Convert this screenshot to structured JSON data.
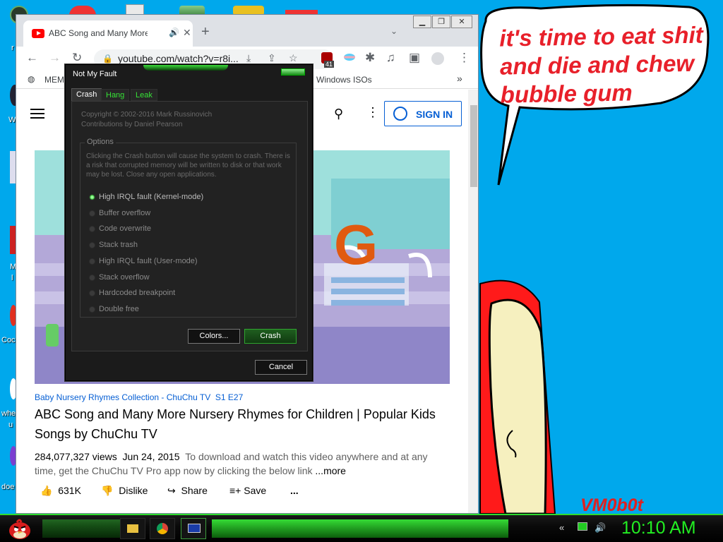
{
  "desktop": {
    "icon_labels": [
      "r",
      "W",
      "M",
      "l",
      "Coc",
      "whe",
      "u",
      "doe"
    ]
  },
  "drawing": {
    "speech_lines": [
      "it's time to eat shit",
      "and die and chew",
      "bubble gum"
    ],
    "signature": "VM0b0t",
    "colors": {
      "text": "#e8202a",
      "blob": "#ff1a1a",
      "skin": "#f6f0bf",
      "sky": "#00a8ec"
    }
  },
  "browser": {
    "tab_title": "ABC Song and Many More N",
    "tab_new_label": "+",
    "tab_search_icon": "chevron-down-icon",
    "window_buttons": [
      "minimize",
      "restore",
      "close"
    ],
    "url": "youtube.com/watch?v=r8i...",
    "extension_badge": "41",
    "bookmarks": [
      "MEMZ",
      "Windows ISOs"
    ],
    "bookmark_overflow": "»"
  },
  "youtube": {
    "sign_in_label": "SIGN IN",
    "channel": "Baby Nursery Rhymes Collection - ChuChu TV",
    "episode": "S1 E27",
    "title": "ABC Song and Many More Nursery Rhymes for Children | Popular Kids Songs by ChuChu TV",
    "views": "284,077,327 views",
    "date": "Jun 24, 2015",
    "description": "To download and watch this video anywhere and at any time, get the ChuChu TV Pro app now by clicking the below link",
    "more_label": "...more",
    "likes": "631K",
    "dislike_label": "Dislike",
    "share_label": "Share",
    "save_label": "Save",
    "more_actions": "...",
    "thumbnail_letter": "G"
  },
  "notmyfault": {
    "title": "Not My Fault",
    "tabs": [
      "Crash",
      "Hang",
      "Leak"
    ],
    "active_tab": "Crash",
    "copyright": "Copyright © 2002-2016 Mark Russinovich",
    "contributions": "Contributions by Daniel Pearson",
    "options_label": "Options",
    "warning": "Clicking the Crash button will cause the system to crash. There is a risk that corrupted memory will be written to disk or that work may be lost. Close any open applications.",
    "options": [
      "High IRQL fault (Kernel-mode)",
      "Buffer overflow",
      "Code overwrite",
      "Stack trash",
      "High IRQL fault (User-mode)",
      "Stack overflow",
      "Hardcoded breakpoint",
      "Double free"
    ],
    "selected_index": 0,
    "colors_label": "Colors...",
    "crash_label": "Crash",
    "cancel_label": "Cancel",
    "accent": "#36e336"
  },
  "taskbar": {
    "clock": "10:10 AM",
    "accent": "#22ee22"
  }
}
